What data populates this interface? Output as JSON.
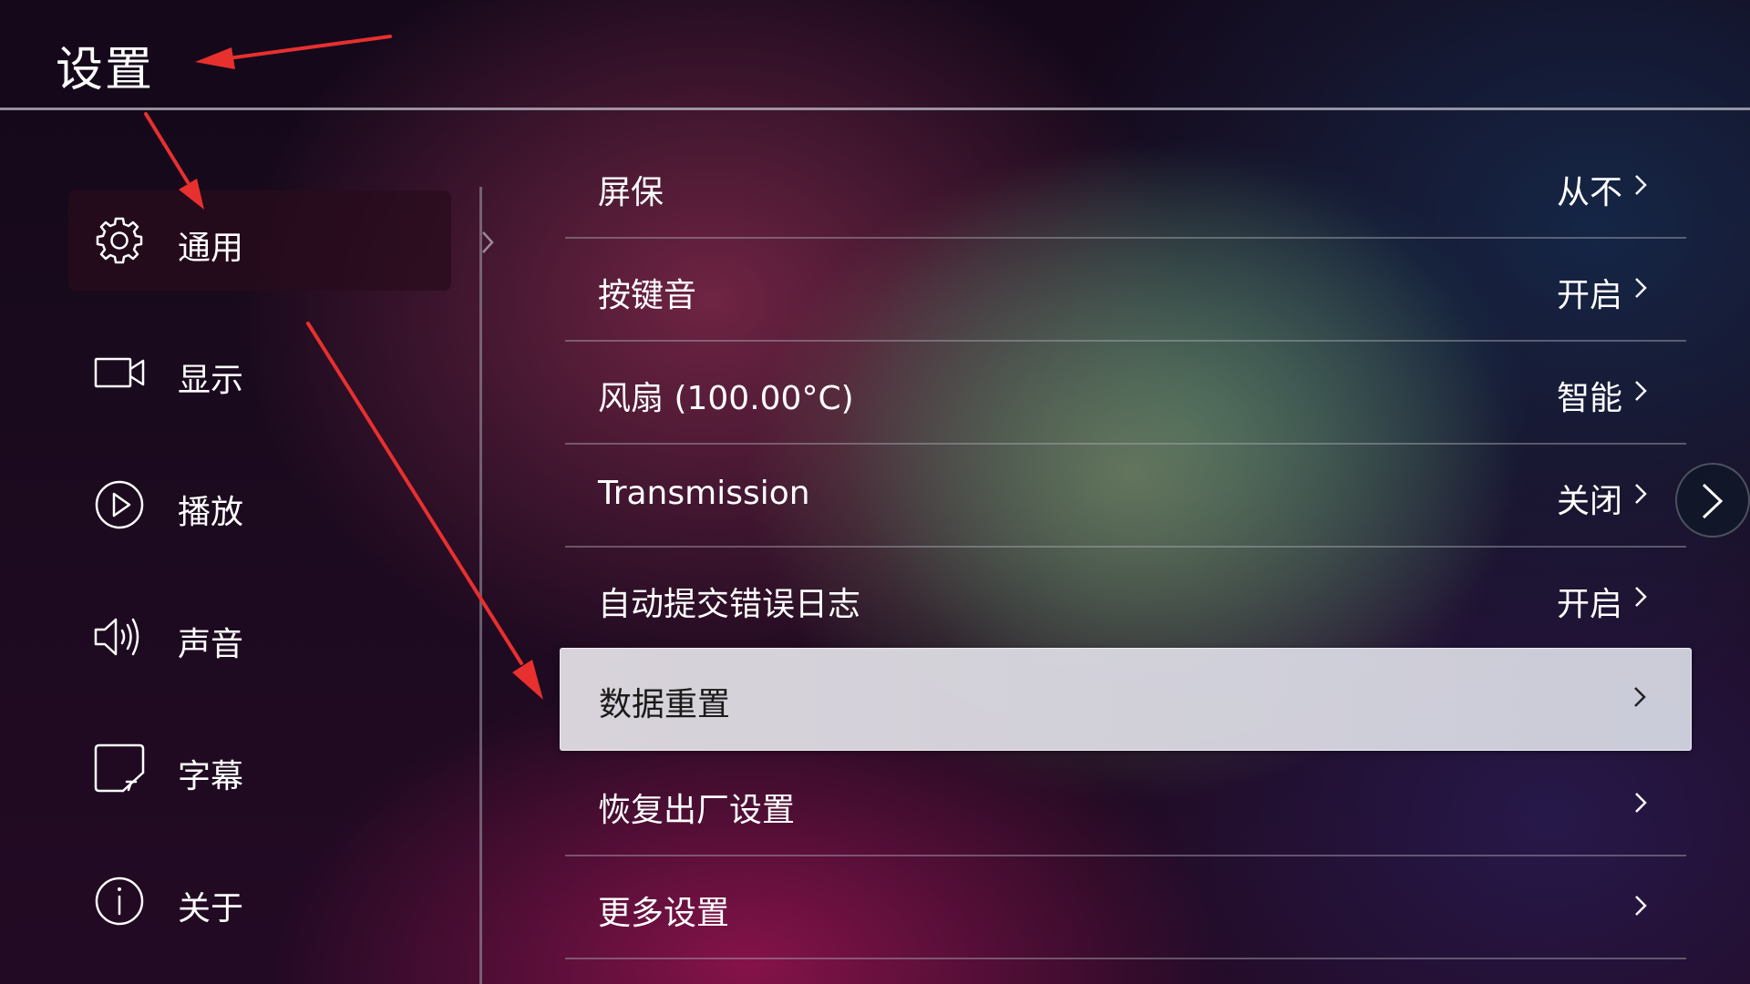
{
  "header": {
    "title": "设置"
  },
  "sidebar": {
    "items": [
      {
        "label": "通用",
        "icon": "gear-icon",
        "selected": true
      },
      {
        "label": "显示",
        "icon": "display-icon",
        "selected": false
      },
      {
        "label": "播放",
        "icon": "play-icon",
        "selected": false
      },
      {
        "label": "声音",
        "icon": "speaker-icon",
        "selected": false
      },
      {
        "label": "字幕",
        "icon": "subtitle-icon",
        "selected": false
      },
      {
        "label": "关于",
        "icon": "info-icon",
        "selected": false
      }
    ]
  },
  "settings": {
    "rows": [
      {
        "label": "屏保",
        "value": "从不"
      },
      {
        "label": "按键音",
        "value": "开启"
      },
      {
        "label": "风扇 (100.00°C)",
        "value": "智能"
      },
      {
        "label": "Transmission",
        "value": "关闭"
      },
      {
        "label": "自动提交错误日志",
        "value": "开启"
      },
      {
        "label": "数据重置",
        "value": "",
        "focused": true
      },
      {
        "label": "恢复出厂设置",
        "value": ""
      },
      {
        "label": "更多设置",
        "value": ""
      }
    ]
  },
  "colors": {
    "annotation_arrow": "#e8302e",
    "focused_row_bg": "#dcd9e0",
    "divider": "#a0a0aa"
  },
  "controls": {
    "scroll_next_icon": "chevron-right-icon"
  }
}
